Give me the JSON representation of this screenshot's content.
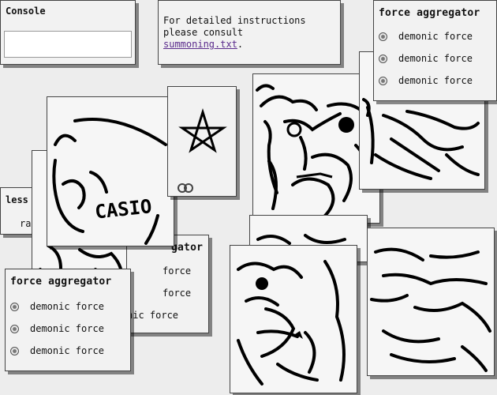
{
  "console": {
    "title": "Console",
    "input_value": "",
    "input_placeholder": ""
  },
  "info": {
    "line1": "For detailed instructions",
    "line2": "please consult",
    "link_text": "summoning.txt",
    "after_link": "."
  },
  "force_aggregator_top": {
    "title": "force aggregator",
    "items": [
      "demonic force",
      "demonic force",
      "demonic force"
    ]
  },
  "force_aggregator_bottom": {
    "title": "force aggregator",
    "items": [
      "demonic force",
      "demonic force",
      "demonic force"
    ]
  },
  "partial_middle_window": {
    "title_fragment": "gator",
    "items": [
      "force",
      "force",
      "nic force"
    ]
  },
  "partial_left_window": {
    "title_fragment": "less",
    "line_fragment": "ra"
  },
  "images": {
    "casio_text": "CASIO",
    "pentagram": "pentagram-icon"
  }
}
